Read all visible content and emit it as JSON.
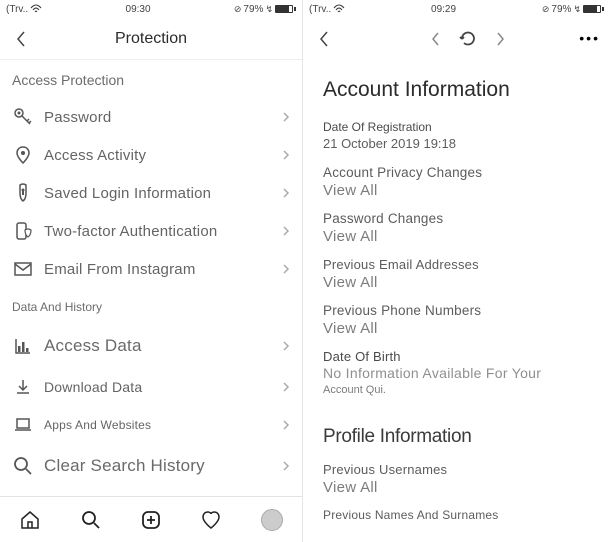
{
  "statusbar": {
    "carrier": "(Trv..",
    "clock_left": "09:30",
    "clock_right": "09:29",
    "battery_pct": "79%"
  },
  "left": {
    "header_title": "Protection",
    "sections": {
      "access_protection": "Access Protection",
      "data_history": "Data And History"
    },
    "items": {
      "password": "Password",
      "access_activity": "Access Activity",
      "saved_login": "Saved Login Information",
      "two_factor": "Two-factor Authentication",
      "email_from": "Email From Instagram",
      "access_data": "Access Data",
      "download_data": "Download Data",
      "apps_websites": "Apps And Websites",
      "clear_search": "Clear Search History"
    }
  },
  "right": {
    "h1": "Account Information",
    "reg_label": "Date Of Registration",
    "reg_value": "21 October 2019 19:18",
    "privacy_label": "Account Privacy Changes",
    "password_label": "Password Changes",
    "prev_email_label": "Previous Email Addresses",
    "prev_phone_label": "Previous Phone Numbers",
    "dob_label": "Date Of Birth",
    "noinfo": "No Information Available For Your",
    "noinfo2": "Account Qui.",
    "view_all": "View All",
    "h2": "Profile Information",
    "prev_usernames": "Previous Usernames",
    "prev_names": "Previous Names And Surnames"
  }
}
